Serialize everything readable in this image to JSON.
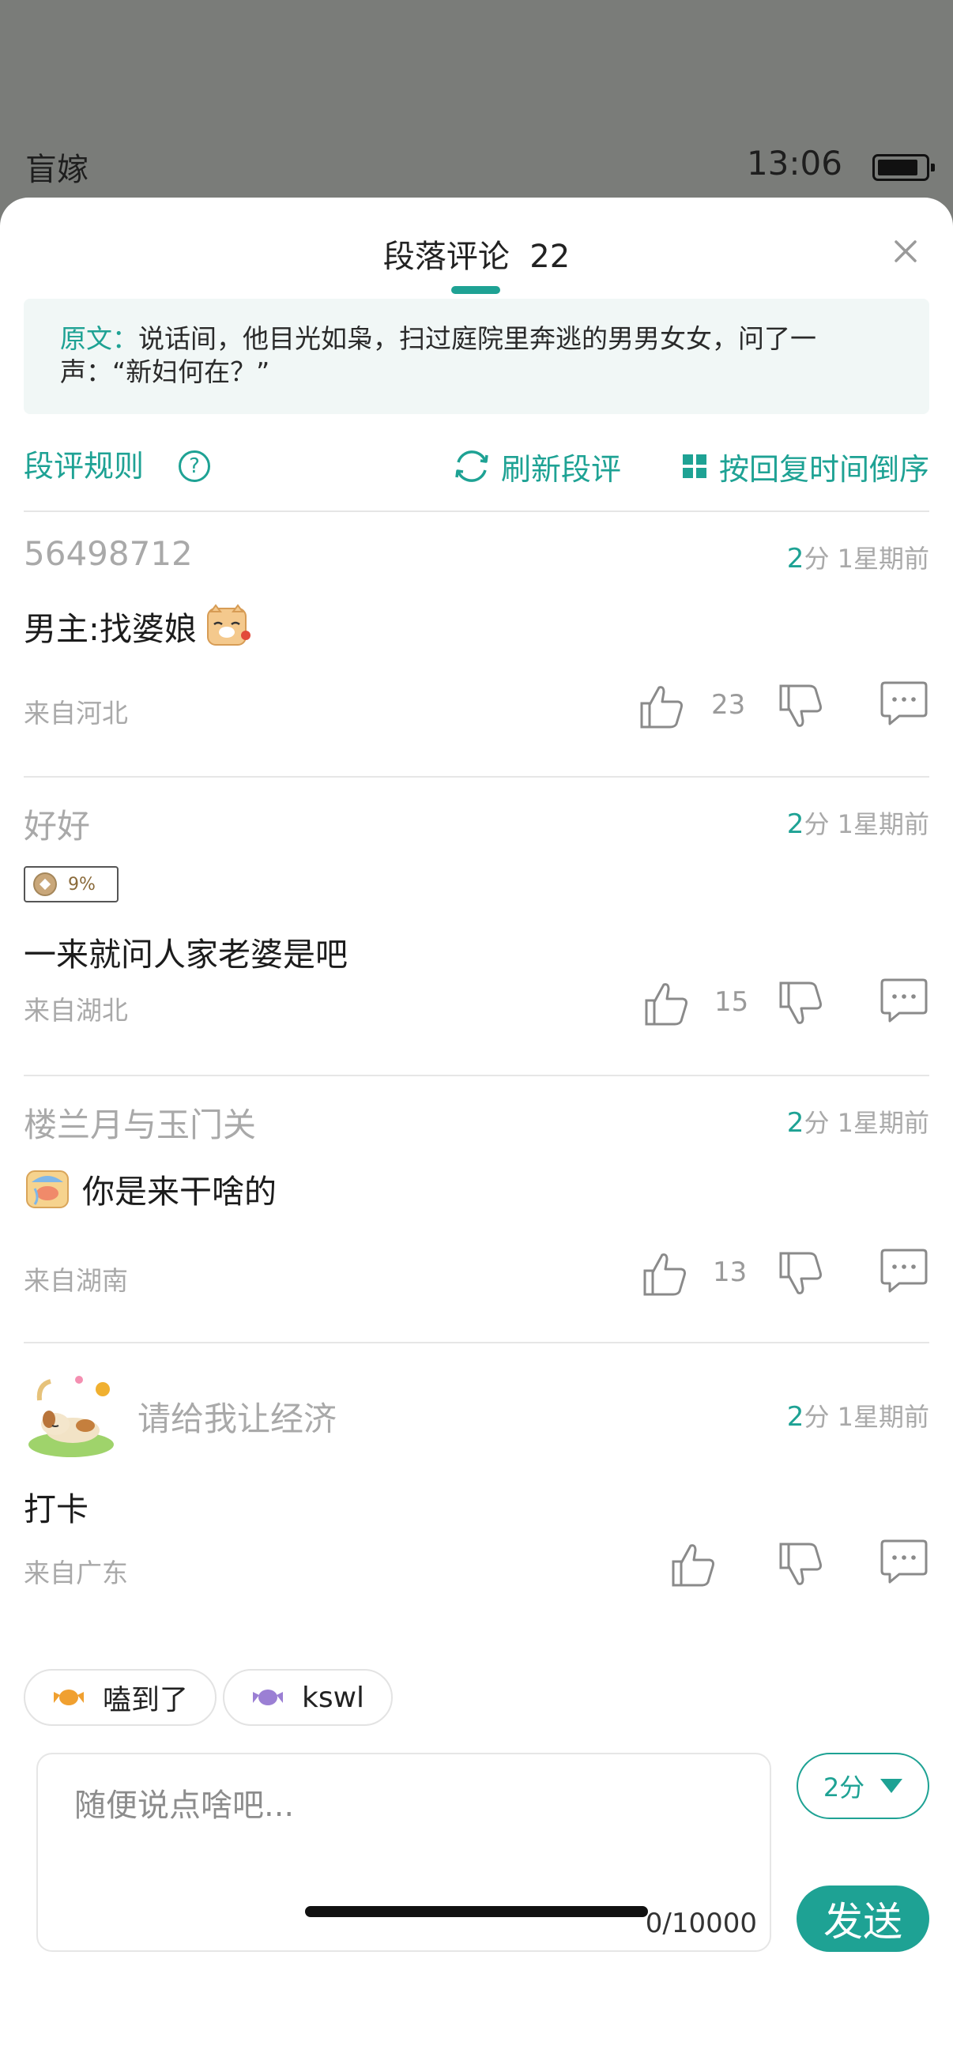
{
  "status_bar": {
    "app_name": "盲嫁",
    "time": "13:06"
  },
  "panel": {
    "title": "段落评论",
    "count": "22",
    "quote_label": "原文：",
    "quote_text": "说话间，他目光如枭，扫过庭院里奔逃的男男女女，问了一声：“新妇何在？”",
    "rules_label": "段评规则",
    "help_symbol": "?",
    "refresh_label": "刷新段评",
    "sort_label": "按回复时间倒序"
  },
  "comments": [
    {
      "user": "56498712",
      "score": "2",
      "score_unit": "分",
      "time": "1星期前",
      "text": "男主:找婆娘",
      "emoji": "cat-emoji",
      "from": "来自河北",
      "likes": "23"
    },
    {
      "user": "好好",
      "badge": "9%",
      "score": "2",
      "score_unit": "分",
      "time": "1星期前",
      "text": "一来就问人家老婆是吧",
      "from": "来自湖北",
      "likes": "15"
    },
    {
      "user": "楼兰月与玉门关",
      "score": "2",
      "score_unit": "分",
      "time": "1星期前",
      "text": "你是来干啥的",
      "emoji": "crying-emoji",
      "from": "来自湖南",
      "likes": "13"
    },
    {
      "user": "请给我让经济",
      "avatar": "sleeping-dog-avatar",
      "score": "2",
      "score_unit": "分",
      "time": "1星期前",
      "text": "打卡",
      "from": "来自广东",
      "likes": ""
    }
  ],
  "quick_tags": [
    {
      "label": "嗑到了",
      "color": "#f0a030"
    },
    {
      "label": "kswl",
      "color": "#9b7fd4"
    }
  ],
  "composer": {
    "placeholder": "随便说点啥吧...",
    "counter": "0/10000",
    "score_value": "2分",
    "send_label": "发送"
  },
  "colors": {
    "accent": "#1ea294",
    "muted": "#a9a9a9"
  }
}
